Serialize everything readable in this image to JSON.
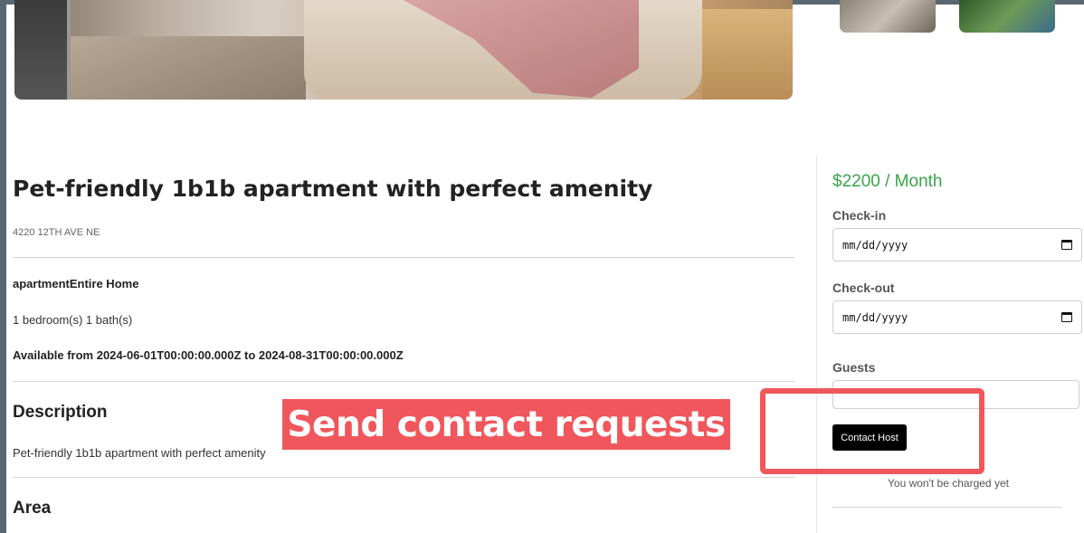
{
  "listing": {
    "title": "Pet-friendly 1b1b apartment with perfect amenity",
    "address": "4220 12TH AVE NE",
    "type_label": "apartmentEntire Home",
    "rooms": "1 bedroom(s) 1 bath(s)",
    "availability": "Available from 2024-06-01T00:00:00.000Z to 2024-08-31T00:00:00.000Z",
    "description_heading": "Description",
    "description": "Pet-friendly 1b1b apartment with perfect amenity",
    "area_heading": "Area"
  },
  "booking": {
    "price": "$2200 / Month",
    "checkin_label": "Check-in",
    "checkin_value": "mm/dd/yyyy",
    "checkout_label": "Check-out",
    "checkout_value": "mm/dd/yyyy",
    "guests_label": "Guests",
    "guests_value": "",
    "contact_button": "Contact Host",
    "note": "You won't be charged yet"
  },
  "annotation": {
    "caption": "Send contact requests",
    "color": "#f0575c"
  },
  "icons": {
    "calendar": "calendar-icon"
  },
  "colors": {
    "price": "#3aa44a",
    "button_bg": "#000000"
  }
}
